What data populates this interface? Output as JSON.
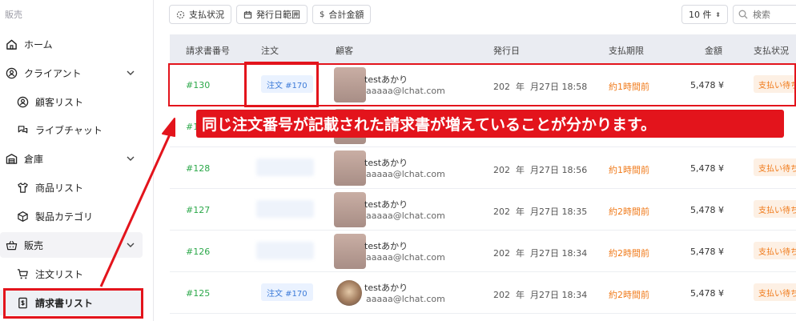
{
  "sidebar": {
    "section_label": "販売",
    "items": [
      {
        "label": "ホーム"
      },
      {
        "label": "クライアント"
      },
      {
        "label": "顧客リスト"
      },
      {
        "label": "ライブチャット"
      },
      {
        "label": "倉庫"
      },
      {
        "label": "商品リスト"
      },
      {
        "label": "製品カテゴリ"
      },
      {
        "label": "販売"
      },
      {
        "label": "注文リスト"
      },
      {
        "label": "請求書リスト"
      }
    ]
  },
  "toolbar": {
    "filter_payment": "支払状況",
    "filter_issue_date": "発行日範囲",
    "filter_total": "合計金額",
    "page_size": "10 件",
    "search_placeholder": "検索"
  },
  "table": {
    "headers": [
      "請求書番号",
      "注文",
      "顧客",
      "発行日",
      "支払期限",
      "金額",
      "支払状況"
    ],
    "rows": [
      {
        "invoice": "#130",
        "order": "注文 #170",
        "customer": "testあかり",
        "email": "aaaaa@lchat.com",
        "date_year": "202",
        "date_month": "年",
        "date_rest": "月27日 18:58",
        "due": "約1時間前",
        "amount": "5,478 ¥",
        "status": "支払い待ち"
      },
      {
        "invoice": "#1",
        "order": "",
        "customer": "",
        "email": "",
        "date_year": "",
        "date_month": "",
        "date_rest": "",
        "due": "",
        "amount": "",
        "status": ""
      },
      {
        "invoice": "#128",
        "order": "",
        "customer": "testあかり",
        "email": "aaaaa@lchat.com",
        "date_year": "202",
        "date_month": "年",
        "date_rest": "月27日 18:56",
        "due": "約1時間前",
        "amount": "5,478 ¥",
        "status": "支払い待ち"
      },
      {
        "invoice": "#127",
        "order": "",
        "customer": "testあかり",
        "email": "aaaaa@lchat.com",
        "date_year": "202",
        "date_month": "年",
        "date_rest": "月27日 18:35",
        "due": "約2時間前",
        "amount": "5,478 ¥",
        "status": "支払い待ち"
      },
      {
        "invoice": "#126",
        "order": "",
        "customer": "testあかり",
        "email": "aaaaa@lchat.com",
        "date_year": "202",
        "date_month": "年",
        "date_rest": "月27日 18:34",
        "due": "約2時間前",
        "amount": "5,478 ¥",
        "status": "支払い待ち"
      },
      {
        "invoice": "#125",
        "order": "注文 #170",
        "customer": "testあかり",
        "email": "aaaaa@lchat.com",
        "date_year": "202",
        "date_month": "年",
        "date_rest": "月27日 18:34",
        "due": "約2時間前",
        "amount": "5,478 ¥",
        "status": "支払い待ち"
      }
    ]
  },
  "annotation": {
    "callout_text": "同じ注文番号が記載された請求書が増えていることが分かります。",
    "color": "#e3141c"
  }
}
